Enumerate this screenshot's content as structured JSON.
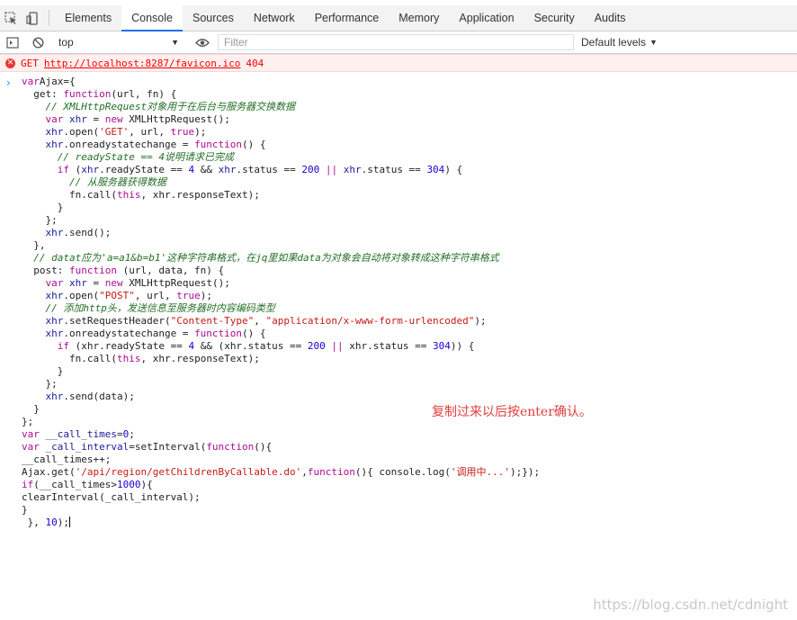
{
  "tabs": [
    {
      "label": "Elements",
      "active": false
    },
    {
      "label": "Console",
      "active": true
    },
    {
      "label": "Sources",
      "active": false
    },
    {
      "label": "Network",
      "active": false
    },
    {
      "label": "Performance",
      "active": false
    },
    {
      "label": "Memory",
      "active": false
    },
    {
      "label": "Application",
      "active": false
    },
    {
      "label": "Security",
      "active": false
    },
    {
      "label": "Audits",
      "active": false
    }
  ],
  "toolbar": {
    "context": "top",
    "filter_placeholder": "Filter",
    "levels": "Default levels"
  },
  "error": {
    "method": "GET",
    "url": "http://localhost:8287/favicon.ico",
    "status": "404"
  },
  "code_lines": [
    [
      [
        "kw",
        "var"
      ],
      [
        "",
        "Ajax={"
      ]
    ],
    [
      [
        "",
        "  get: "
      ],
      [
        "kw",
        "function"
      ],
      [
        "",
        "(url, fn) {"
      ]
    ],
    [
      [
        "cm",
        "    // XMLHttpRequest对象用于在后台与服务器交换数据"
      ]
    ],
    [
      [
        "",
        "    "
      ],
      [
        "kw",
        "var"
      ],
      [
        "var",
        " xhr"
      ],
      [
        "",
        " = "
      ],
      [
        "kw",
        "new"
      ],
      [
        "",
        " XMLHttpRequest();"
      ]
    ],
    [
      [
        "var",
        "    xhr"
      ],
      [
        "",
        ".open("
      ],
      [
        "str",
        "'GET'"
      ],
      [
        "",
        ", url, "
      ],
      [
        "kw",
        "true"
      ],
      [
        "",
        ");"
      ]
    ],
    [
      [
        "var",
        "    xhr"
      ],
      [
        "",
        ".onreadystatechange = "
      ],
      [
        "kw",
        "function"
      ],
      [
        "",
        "() {"
      ]
    ],
    [
      [
        "cm",
        "      // readyState == 4说明请求已完成"
      ]
    ],
    [
      [
        "",
        "      "
      ],
      [
        "kw",
        "if"
      ],
      [
        "",
        " ("
      ],
      [
        "var",
        "xhr"
      ],
      [
        "",
        ".readyState == "
      ],
      [
        "num",
        "4"
      ],
      [
        "",
        " && "
      ],
      [
        "var",
        "xhr"
      ],
      [
        "",
        ".status == "
      ],
      [
        "num",
        "200"
      ],
      [
        "",
        ""
      ],
      [
        "kw",
        " ||"
      ],
      [
        "var",
        " xhr"
      ],
      [
        "",
        ".status == "
      ],
      [
        "num",
        "304"
      ],
      [
        "",
        ") {"
      ]
    ],
    [
      [
        "cm",
        "        // 从服务器获得数据"
      ]
    ],
    [
      [
        "",
        "        fn.call("
      ],
      [
        "kw",
        "this"
      ],
      [
        "",
        ", xhr.responseText);"
      ]
    ],
    [
      [
        "",
        "      }"
      ]
    ],
    [
      [
        "",
        "    };"
      ]
    ],
    [
      [
        "var",
        "    xhr"
      ],
      [
        "",
        ".send();"
      ]
    ],
    [
      [
        "",
        "  },"
      ]
    ],
    [
      [
        "cm",
        "  // datat应为'a=a1&b=b1'这种字符串格式，在jq里如果data为对象会自动将对象转成这种字符串格式"
      ]
    ],
    [
      [
        "",
        "  post: "
      ],
      [
        "kw",
        "function"
      ],
      [
        "",
        " (url, data, fn) {"
      ]
    ],
    [
      [
        "",
        "    "
      ],
      [
        "kw",
        "var"
      ],
      [
        "var",
        " xhr"
      ],
      [
        "",
        " = "
      ],
      [
        "kw",
        "new"
      ],
      [
        "",
        " XMLHttpRequest();"
      ]
    ],
    [
      [
        "var",
        "    xhr"
      ],
      [
        "",
        ".open("
      ],
      [
        "str",
        "\"POST\""
      ],
      [
        "",
        ", url, "
      ],
      [
        "kw",
        "true"
      ],
      [
        "",
        ");"
      ]
    ],
    [
      [
        "cm",
        "    // 添加http头，发送信息至服务器时内容编码类型"
      ]
    ],
    [
      [
        "var",
        "    xhr"
      ],
      [
        "",
        ".setRequestHeader("
      ],
      [
        "str",
        "\"Content-Type\""
      ],
      [
        "",
        ", "
      ],
      [
        "str",
        "\"application/x-www-form-urlencoded\""
      ],
      [
        "",
        ");"
      ]
    ],
    [
      [
        "var",
        "    xhr"
      ],
      [
        "",
        ".onreadystatechange = "
      ],
      [
        "kw",
        "function"
      ],
      [
        "",
        "() {"
      ]
    ],
    [
      [
        "",
        "      "
      ],
      [
        "kw",
        "if"
      ],
      [
        "",
        " (xhr.readyState == "
      ],
      [
        "num",
        "4"
      ],
      [
        "",
        " && (xhr.status == "
      ],
      [
        "num",
        "200"
      ],
      [
        "kw",
        " ||"
      ],
      [
        "",
        " xhr.status == "
      ],
      [
        "num",
        "304"
      ],
      [
        "",
        "))"
      ],
      [
        "",
        " {"
      ]
    ],
    [
      [
        "",
        "        fn.call("
      ],
      [
        "kw",
        "this"
      ],
      [
        "",
        ", xhr.responseText);"
      ]
    ],
    [
      [
        "",
        "      }"
      ]
    ],
    [
      [
        "",
        "    };"
      ]
    ],
    [
      [
        "var",
        "    xhr"
      ],
      [
        "",
        ".send(data);"
      ]
    ],
    [
      [
        "",
        "  }"
      ]
    ],
    [
      [
        "",
        "};"
      ]
    ],
    [
      [
        "kw",
        "var"
      ],
      [
        "var",
        " __call_times"
      ],
      [
        "",
        "="
      ],
      [
        "num",
        "0"
      ],
      [
        "",
        ";"
      ]
    ],
    [
      [
        "kw",
        "var"
      ],
      [
        "var",
        " _call_interval"
      ],
      [
        "",
        "=setInterval("
      ],
      [
        "kw",
        "function"
      ],
      [
        "",
        "(){"
      ]
    ],
    [
      [
        "",
        "__call_times++;"
      ]
    ],
    [
      [
        "",
        "Ajax.get("
      ],
      [
        "str",
        "'/api/region/getChildrenByCallable.do'"
      ],
      [
        "",
        ","
      ],
      [
        "kw",
        "function"
      ],
      [
        "",
        "(){ console.log("
      ],
      [
        "str",
        "'调用中...'"
      ],
      [
        "",
        ");});"
      ]
    ],
    [
      [
        "kw",
        "if"
      ],
      [
        "",
        "(__call_times>"
      ],
      [
        "num",
        "1000"
      ],
      [
        "",
        ")"
      ],
      [
        "",
        "{"
      ]
    ],
    [
      [
        "",
        "clearInterval(_call_interval);"
      ]
    ],
    [
      [
        "",
        "}"
      ]
    ],
    [
      [
        "",
        " }, "
      ],
      [
        "num",
        "10"
      ],
      [
        "",
        ");"
      ]
    ]
  ],
  "annotation": "复制过来以后按enter确认。",
  "watermark": "https://blog.csdn.net/cdnight",
  "icons": {
    "inspect": "inspect-element-icon",
    "device": "device-toolbar-icon",
    "sidebar": "show-sidebar-icon",
    "clear": "clear-console-icon",
    "eye": "live-expression-eye-icon",
    "error": "error-circle-icon",
    "prompt": "console-prompt-chevron-icon"
  }
}
